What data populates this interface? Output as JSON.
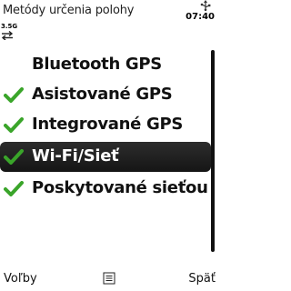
{
  "title_bar": {
    "title": "Metódy určenia polohy",
    "clock": "07:40",
    "network_label": "3.5G"
  },
  "list": {
    "items": [
      {
        "label": "Bluetooth GPS",
        "checked": false,
        "selected": false
      },
      {
        "label": "Asistované GPS",
        "checked": true,
        "selected": false
      },
      {
        "label": "Integrované GPS",
        "checked": true,
        "selected": false
      },
      {
        "label": "Wi-Fi/Sieť",
        "checked": true,
        "selected": true
      },
      {
        "label": "Poskytované sieťou",
        "checked": true,
        "selected": false
      }
    ]
  },
  "softkeys": {
    "left": "Voľby",
    "right": "Späť",
    "center_icon": "menu-icon"
  },
  "colors": {
    "check_green": "#3aa52a",
    "selection_bg": "#1e1e1e",
    "selection_text": "#ffffff"
  }
}
